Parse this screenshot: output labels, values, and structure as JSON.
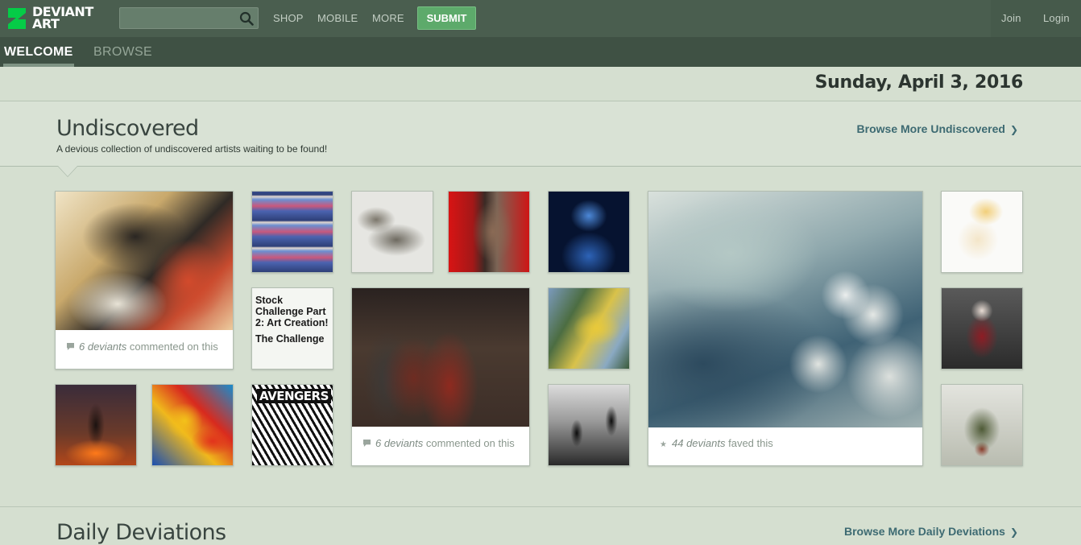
{
  "header": {
    "logo_text_line1": "DEVIANT",
    "logo_text_line2": "ART",
    "search_placeholder": "",
    "nav": [
      "SHOP",
      "MOBILE",
      "MORE"
    ],
    "submit_label": "SUBMIT",
    "join_label": "Join",
    "login_label": "Login"
  },
  "tabs": [
    {
      "label": "WELCOME",
      "active": true
    },
    {
      "label": "BROWSE",
      "active": false
    }
  ],
  "date": "Sunday, April 3, 2016",
  "undiscovered": {
    "title": "Undiscovered",
    "subtitle": "A devious collection of undiscovered artists waiting to be found!",
    "browse_more": "Browse More Undiscovered",
    "items": [
      {
        "kind": "anime-figure-illustration",
        "caption_count": "6 deviants",
        "caption_rest": " commented on this"
      },
      {
        "kind": "comic-page"
      },
      {
        "kind": "tank-3d-model"
      },
      {
        "kind": "red-figure-painting"
      },
      {
        "kind": "blue-portrait"
      },
      {
        "kind": "white-flowers-photo",
        "caption_count": "44 deviants",
        "caption_rest": " faved this"
      },
      {
        "kind": "blonde-figure-painting"
      },
      {
        "kind": "literature",
        "title": "Stock Challenge Part 2: Art Creation!",
        "subtitle": "The Challenge"
      },
      {
        "kind": "medieval-soldiers-painting",
        "caption_count": "6 deviants",
        "caption_rest": " commented on this"
      },
      {
        "kind": "yellow-abstract-painting"
      },
      {
        "kind": "harlequin-photo"
      },
      {
        "kind": "fire-scene"
      },
      {
        "kind": "colorful-abstract"
      },
      {
        "kind": "avengers-comic",
        "text": "AVENGERS"
      },
      {
        "kind": "bw-cyclists-photo"
      },
      {
        "kind": "creature-sculpture"
      }
    ]
  },
  "daily": {
    "title": "Daily Deviations",
    "browse_more": "Browse More Daily Deviations"
  }
}
